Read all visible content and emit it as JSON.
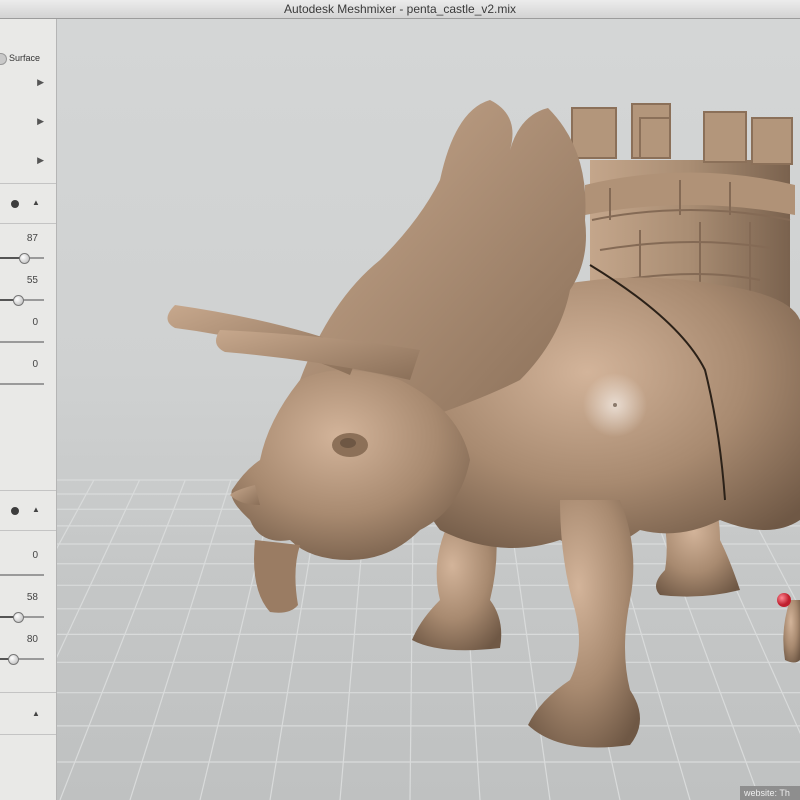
{
  "window": {
    "title": "Autodesk Meshmixer - penta_castle_v2.mix"
  },
  "toolbar": {
    "surface_label": "Surface"
  },
  "panel": {
    "sliders_a": [
      {
        "value": "87",
        "level": 0.55
      },
      {
        "value": "55",
        "level": 0.4
      },
      {
        "value": "0",
        "level": 0.0
      },
      {
        "value": "0",
        "level": 0.0
      }
    ],
    "sliders_b": [
      {
        "value": "0",
        "level": 0.0
      },
      {
        "value": "58",
        "level": 0.4
      },
      {
        "value": "80",
        "level": 0.3
      }
    ]
  },
  "watermark": {
    "text": "website: Th"
  },
  "colors": {
    "model": "#a88a70",
    "grid_line": "#d8dada",
    "marker": "#e03040"
  }
}
